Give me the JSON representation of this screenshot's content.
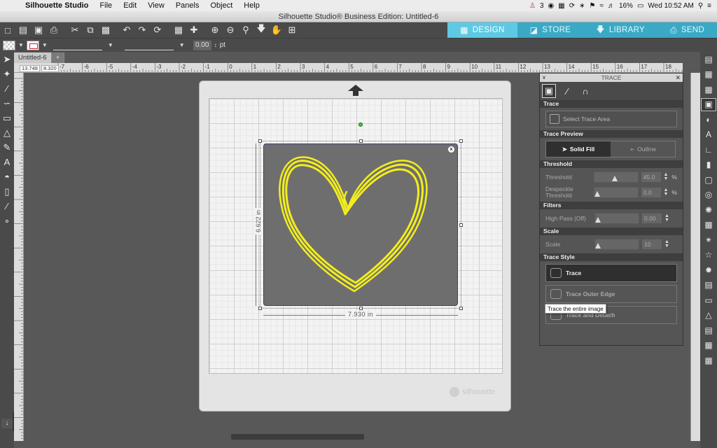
{
  "menubar": {
    "app": "Silhouette Studio",
    "items": [
      "File",
      "Edit",
      "View",
      "Panels",
      "Object",
      "Help"
    ],
    "status_count": "3",
    "battery": "16%",
    "clock": "Wed 10:52 AM"
  },
  "window_title": "Silhouette Studio® Business Edition: Untitled-6",
  "nav": {
    "design": "DESIGN",
    "store": "STORE",
    "library": "LIBRARY",
    "send": "SEND"
  },
  "line": {
    "width_value": "0.00",
    "unit": "pt"
  },
  "doc": {
    "tab": "Untitled-6",
    "add": "+"
  },
  "coords": {
    "x": "13.748",
    "y": "8.320"
  },
  "ruler": {
    "h_labels": [
      "-7",
      "-6",
      "-5",
      "-4",
      "-3",
      "-2",
      "-1",
      "0",
      "1",
      "2",
      "3",
      "4",
      "5",
      "6",
      "7",
      "8",
      "9",
      "10",
      "11",
      "12",
      "13",
      "14",
      "15",
      "16",
      "17",
      "18",
      "19"
    ]
  },
  "canvas": {
    "width_dim": "7.930 in",
    "height_dim": "6.622 in",
    "watermark": "silhouette",
    "close_badge": "x"
  },
  "trace_panel": {
    "title": "TRACE",
    "sec_trace": "Trace",
    "select_area": "Select Trace Area",
    "sec_preview": "Trace Preview",
    "solid_fill": "Solid Fill",
    "outline": "Outline",
    "sec_threshold": "Threshold",
    "threshold_label": "Threshold",
    "threshold_value": "45.0",
    "despeckle_label1": "Despeckle",
    "despeckle_label2": "Threshold",
    "despeckle_value": "0.0",
    "pct": "%",
    "sec_filters": "Filters",
    "highpass_label": "High Pass (Off)",
    "highpass_value": "0.00",
    "sec_scale": "Scale",
    "scale_label": "Scale",
    "scale_value": "10",
    "sec_style": "Trace Style",
    "style_trace": "Trace",
    "style_outer": "Trace Outer Edge",
    "style_detach": "Trace and Detach",
    "tooltip": "Trace the entire image"
  },
  "controls": {
    "threshold": 0.45,
    "despeckle": 0.0,
    "highpass": 0.0,
    "scale": 0.0
  },
  "colors": {
    "accent": "#3aa9c6",
    "accent_active": "#5ec9e3",
    "trace_yellow": "#f2ee1c"
  }
}
